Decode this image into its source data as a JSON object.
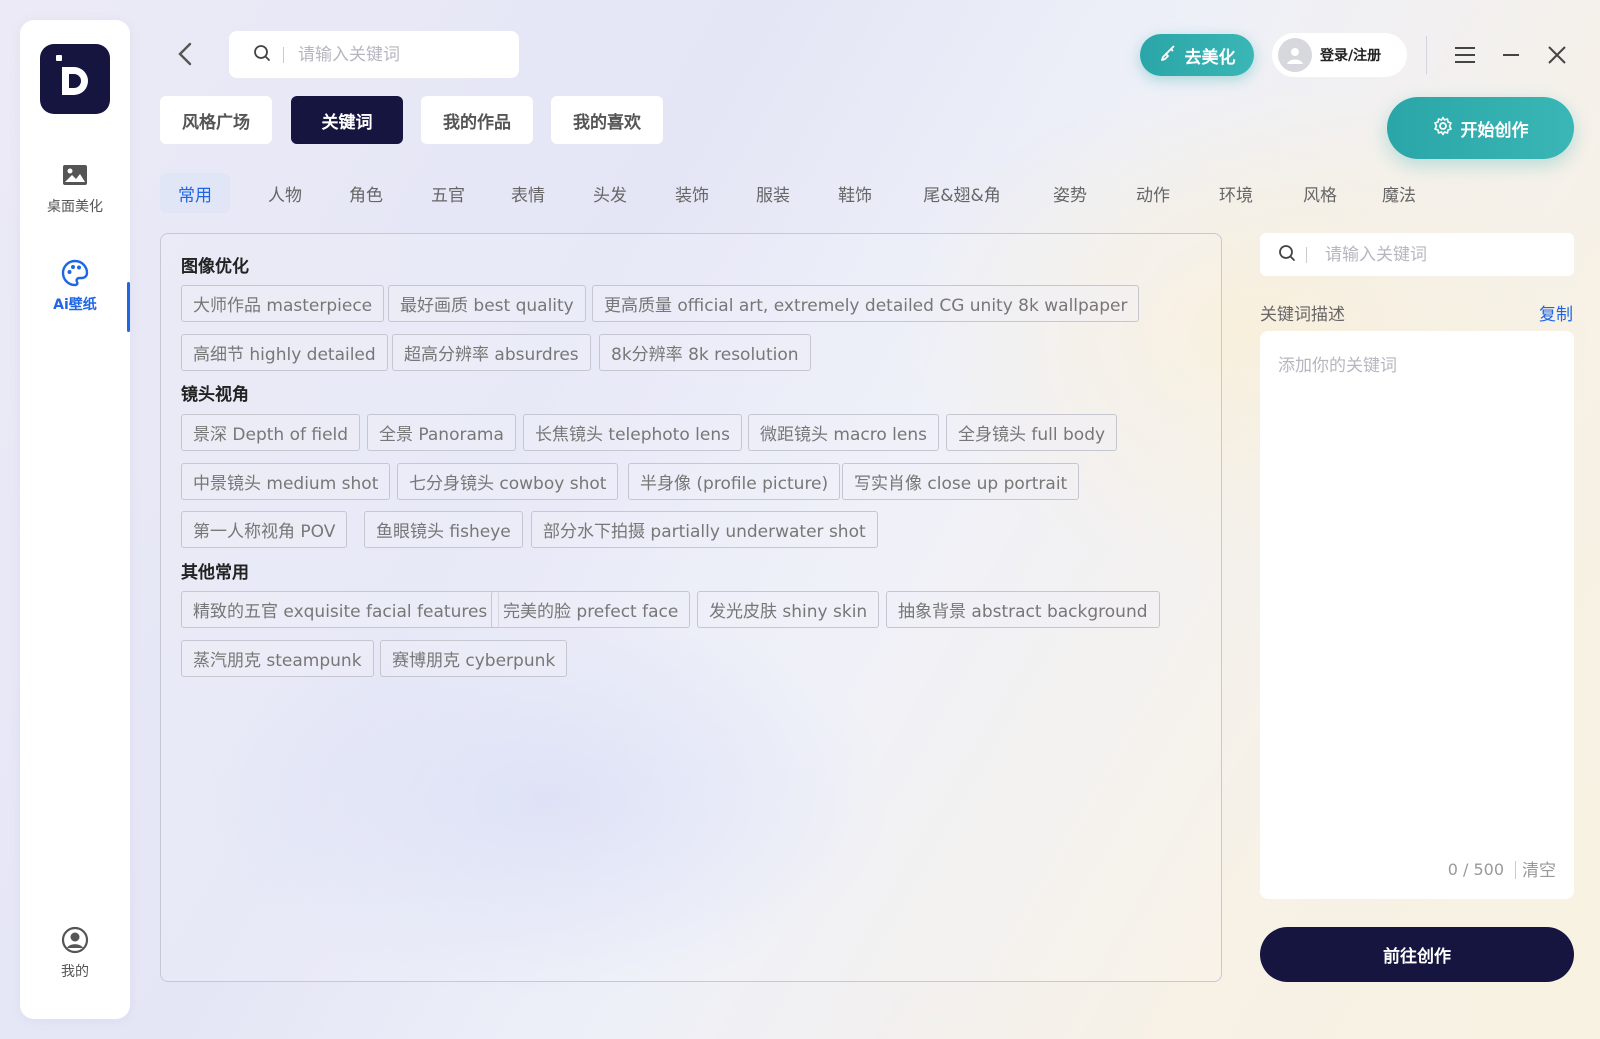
{
  "sidebar": {
    "items": [
      {
        "label": "桌面美化",
        "icon": "image-icon"
      },
      {
        "label": "Ai壁纸",
        "icon": "palette-icon"
      },
      {
        "label": "我的",
        "icon": "user-icon"
      }
    ]
  },
  "header": {
    "search_placeholder": "请输入关键词",
    "beautify_label": "去美化",
    "login_label": "登录/注册",
    "create_label": "开始创作"
  },
  "nav_tabs": [
    "风格广场",
    "关键词",
    "我的作品",
    "我的喜欢"
  ],
  "categories": [
    "常用",
    "人物",
    "角色",
    "五官",
    "表情",
    "头发",
    "装饰",
    "服装",
    "鞋饰",
    "尾&翅&角",
    "姿势",
    "动作",
    "环境",
    "风格",
    "魔法"
  ],
  "sections": [
    {
      "title": "图像优化",
      "tags": [
        "大师作品 masterpiece",
        "最好画质 best quality",
        "更高质量 official art, extremely detailed CG unity 8k wallpaper",
        "高细节 highly detailed",
        "超高分辨率 absurdres",
        "8k分辨率 8k resolution"
      ]
    },
    {
      "title": "镜头视角",
      "tags": [
        "景深 Depth of field",
        "全景 Panorama",
        "长焦镜头 telephoto lens",
        "微距镜头 macro lens",
        "全身镜头 full body",
        "中景镜头 medium shot",
        "七分身镜头 cowboy shot",
        "半身像 (profile picture)",
        "写实肖像 close up portrait",
        "第一人称视角 POV",
        "鱼眼镜头 fisheye",
        "部分水下拍摄 partially underwater shot"
      ]
    },
    {
      "title": "其他常用",
      "tags": [
        "精致的五官 exquisite facial features",
        "完美的脸 prefect face",
        "发光皮肤 shiny skin",
        "抽象背景 abstract background",
        "蒸汽朋克 steampunk",
        "赛博朋克 cyberpunk"
      ]
    }
  ],
  "right_panel": {
    "search_placeholder": "请输入关键词",
    "desc_label": "关键词描述",
    "copy_label": "复制",
    "textarea_placeholder": "添加你的关键词",
    "counter": "0 / 500",
    "clear_label": "清空",
    "go_label": "前往创作"
  }
}
